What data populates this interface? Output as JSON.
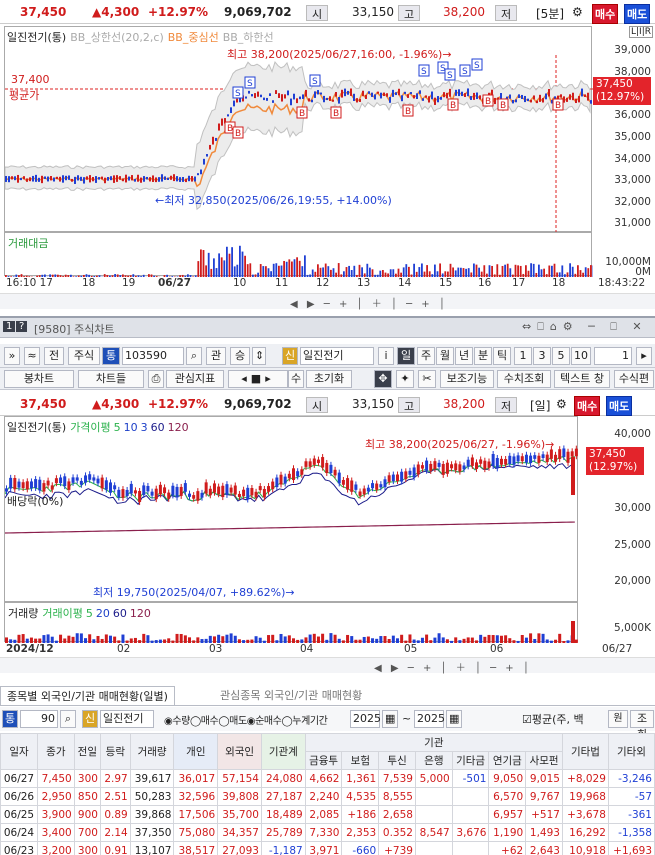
{
  "quote1": {
    "price": "37,450",
    "change": "▲4,300",
    "pct": "+12.97%",
    "volume": "9,069,702",
    "open_lbl": "시",
    "open": "33,150",
    "high_lbl": "고",
    "high": "38,200",
    "low_lbl": "저",
    "period": "[5분]",
    "buy": "매수",
    "sell": "매도"
  },
  "chart1": {
    "legend": [
      "일진전기(통)",
      "BB_상한선(20,2,c)",
      "BB_중심선",
      "BB_하한선"
    ],
    "high_note": "최고 38,200(2025/06/27,16:00, -1.96%)→",
    "low_note": "←최저 32,850(2025/06/26,19:55, +14.00%)",
    "avg_price": "37,400",
    "avg_lbl": "평균가",
    "price_tag": "37,450",
    "price_tag_pct": "(12.97%)",
    "lir": "L|I|R",
    "yticks": [
      "39,000",
      "38,000",
      "37,000",
      "36,000",
      "35,000",
      "34,000",
      "33,000",
      "32,000",
      "31,000"
    ],
    "vol_label": "거래대금",
    "vol_ticks": [
      "10,000M",
      "0M"
    ],
    "xticks": [
      "16:10 17",
      "18",
      "19",
      "06/27",
      "10",
      "11",
      "12",
      "13",
      "14",
      "15",
      "16",
      "17",
      "18"
    ],
    "time": "18:43:22",
    "signals": [
      "S",
      "S",
      "S",
      "S",
      "S",
      "S",
      "S",
      "S",
      "S",
      "B",
      "B",
      "B",
      "B",
      "B",
      "B",
      "B",
      "B",
      "B",
      "B"
    ]
  },
  "window": {
    "num": "1",
    "help": "?",
    "code_title": "[9580] 주식차트"
  },
  "toolbar2": {
    "all": "전",
    "stock": "주식",
    "tong": "통",
    "code": "103590",
    "gwan": "관",
    "seung": "승",
    "sin": "신",
    "name": "일진전기",
    "i": "i",
    "periods": [
      "일",
      "주",
      "월",
      "년",
      "분",
      "틱",
      "1",
      "3",
      "5",
      "10",
      "1"
    ]
  },
  "toolbar3": {
    "items": [
      "봉차트",
      "차트들",
      "관심지표",
      "수",
      "초기화",
      "보조기능",
      "수치조회",
      "텍스트 창",
      "수식편"
    ]
  },
  "quote2": {
    "price": "37,450",
    "change": "▲4,300",
    "pct": "+12.97%",
    "volume": "9,069,702",
    "open_lbl": "시",
    "open": "33,150",
    "high_lbl": "고",
    "high": "38,200",
    "low_lbl": "저",
    "period": "[일]",
    "buy": "매수",
    "sell": "매도"
  },
  "chart2": {
    "legend": [
      "일진전기(통)",
      "가격이평",
      "5",
      "10",
      "3",
      "60",
      "120"
    ],
    "high_note": "최고 38,200(2025/06/27, -1.96%)→",
    "low_note": "최저 19,750(2025/04/07, +89.62%)→",
    "div_note": "배당락(0%)",
    "price_tag": "37,450",
    "price_tag_pct": "(12.97%)",
    "yticks": [
      "40,000",
      "35,000",
      "30,000",
      "25,000",
      "20,000"
    ],
    "vol_label": "거래량",
    "vol_ma": [
      "거래이평",
      "5",
      "20",
      "60",
      "120"
    ],
    "vol_tick": "5,000K",
    "xticks": [
      "2024/12",
      "02",
      "03",
      "04",
      "05",
      "06",
      "06/27"
    ]
  },
  "tabs": [
    "종목별 외국인/기관 매매현황(일별)",
    "관심종목 외국인/기관 매매현황"
  ],
  "filter": {
    "tong": "통",
    "code": "90",
    "sin": "신",
    "name": "일진전기",
    "radio1": "수량",
    "radio2": "매수",
    "radio3": "매도",
    "radio4": "순매수",
    "radio5": "누계기간",
    "year1": "2025",
    "tilde": "~",
    "year2": "2025",
    "check": "평균(주, 백",
    "jo": "조회",
    "won": "원"
  },
  "table": {
    "headers": [
      "일자",
      "종가",
      "전일",
      "등락",
      "거래량",
      "개인",
      "외국인",
      "기관계",
      "금융투",
      "보험",
      "투신",
      "은행",
      "기타금",
      "연기금",
      "사모펀",
      "기타법",
      "기타외"
    ],
    "group": "기관",
    "rows": [
      [
        "06/27",
        "7,450",
        "300",
        "2.97",
        "39,617",
        "36,017",
        "57,154",
        "24,080",
        "4,662",
        "1,361",
        "7,539",
        "5,000",
        "-501",
        "9,050",
        "9,015",
        "+8,029",
        "-3,246"
      ],
      [
        "06/26",
        "2,950",
        "850",
        "2.51",
        "50,283",
        "32,596",
        "39,808",
        "27,187",
        "2,240",
        "4,535",
        "8,555",
        "",
        "",
        "6,570",
        "9,767",
        "19,968",
        "-57"
      ],
      [
        "06/25",
        "3,900",
        "900",
        "0.89",
        "39,868",
        "17,506",
        "35,700",
        "18,489",
        "2,085",
        "+186",
        "2,658",
        "",
        "",
        "6,957",
        "+517",
        "+3,678",
        "-361"
      ],
      [
        "06/24",
        "3,400",
        "700",
        "2.14",
        "37,350",
        "75,080",
        "34,357",
        "25,789",
        "7,330",
        "2,353",
        "0.352",
        "8,547",
        "3,676",
        "1,190",
        "1,493",
        "16,292",
        "-1,358"
      ],
      [
        "06/23",
        "3,200",
        "300",
        "0.91",
        "13,107",
        "38,517",
        "27,093",
        "-1,187",
        "3,971",
        "-660",
        "+739",
        "",
        "",
        "+62",
        "2,643",
        "10,918",
        "+1,693"
      ]
    ]
  },
  "colors": {
    "up": "#d01c1c",
    "down": "#1f3fd4",
    "bb": "#bdbdbd",
    "mid": "#f08a3c",
    "ma5": "#2bb24c",
    "ma20": "#1e40c8",
    "ma60": "#1c1c8a",
    "ma120": "#8a1f4c"
  }
}
